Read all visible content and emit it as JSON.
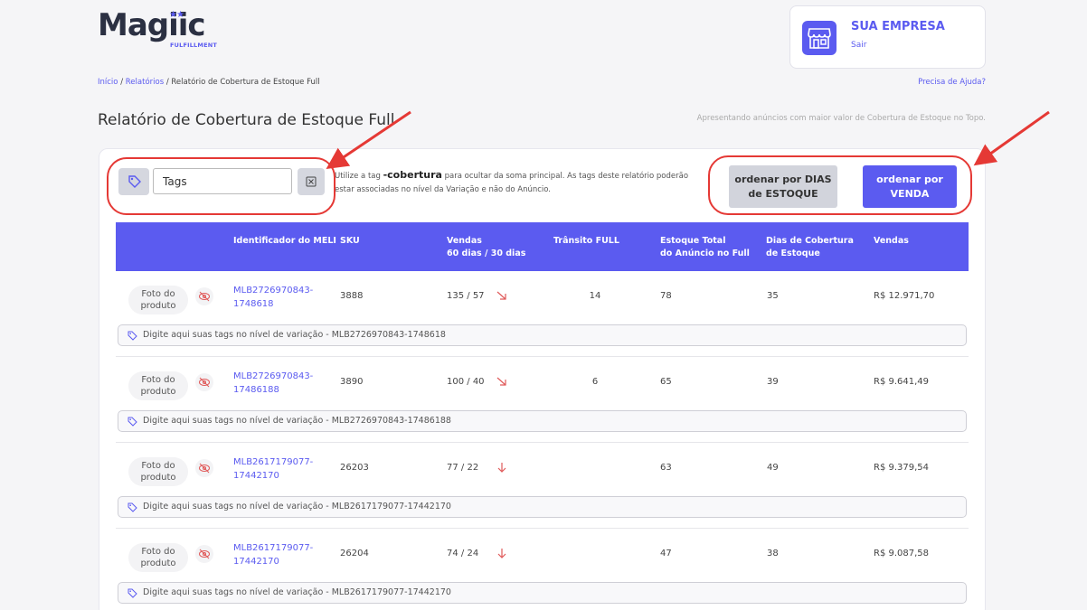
{
  "brand": {
    "logo_text": "Magiic",
    "logo_stars": "★★",
    "logo_sub": "FULFILLMENT",
    "accent": "#5b5bf0"
  },
  "company": {
    "name": "SUA EMPRESA",
    "logout": "Sair"
  },
  "breadcrumb": {
    "home": "Início",
    "reports": "Relatórios",
    "current": "Relatório de Cobertura de Estoque Full"
  },
  "help": "Precisa de Ajuda?",
  "page": {
    "title": "Relatório de Cobertura de Estoque Full",
    "subtitle": "Apresentando anúncios com maior valor de Cobertura de Estoque no Topo."
  },
  "filter": {
    "placeholder": "Tags",
    "info_before": "Utilize a tag ",
    "info_tag": "-cobertura",
    "info_after": " para ocultar da soma principal. As tags deste relatório poderão estar associadas no nível da Variação e não do Anúncio."
  },
  "sort": {
    "by_days_line1": "ordenar por DIAS",
    "by_days_line2": "de ESTOQUE",
    "by_sales_line1": "ordenar por",
    "by_sales_line2": "VENDA"
  },
  "table": {
    "headers": {
      "meli": "Identificador do MELI",
      "sku": "SKU",
      "sales_line1": "Vendas",
      "sales_line2": "60 dias / 30 dias",
      "transit": "Trânsito FULL",
      "stock_line1": "Estoque Total",
      "stock_line2": "do Anúncio no Full",
      "days_line1": "Dias de Cobertura",
      "days_line2": "de Estoque",
      "revenue": "Vendas"
    },
    "photo_label_line1": "Foto do",
    "photo_label_line2": "produto",
    "rows": [
      {
        "meli_line1": "MLB2726970843-",
        "meli_line2": "1748618",
        "sku": "3888",
        "sales": "135 / 57",
        "trend": "diagonal-down",
        "transit": "14",
        "stock": "78",
        "days": "35",
        "revenue": "R$ 12.971,70",
        "variation_tag": "Digite aqui suas tags no nível de variação - MLB2726970843-1748618"
      },
      {
        "meli_line1": "MLB2726970843-",
        "meli_line2": "17486188",
        "sku": "3890",
        "sales": "100 / 40",
        "trend": "diagonal-down",
        "transit": "6",
        "stock": "65",
        "days": "39",
        "revenue": "R$ 9.641,49",
        "variation_tag": "Digite aqui suas tags no nível de variação - MLB2726970843-17486188"
      },
      {
        "meli_line1": "MLB2617179077-",
        "meli_line2": "17442170",
        "sku": "26203",
        "sales": "77 / 22",
        "trend": "down",
        "transit": "",
        "stock": "63",
        "days": "49",
        "revenue": "R$ 9.379,54",
        "variation_tag": "Digite aqui suas tags no nível de variação - MLB2617179077-17442170"
      },
      {
        "meli_line1": "MLB2617179077-",
        "meli_line2": "17442170",
        "sku": "26204",
        "sales": "74 / 24",
        "trend": "down",
        "transit": "",
        "stock": "47",
        "days": "38",
        "revenue": "R$ 9.087,58",
        "variation_tag": "Digite aqui suas tags no nível de variação - MLB2617179077-17442170"
      }
    ]
  },
  "colors": {
    "annotation": "#e53935",
    "trend": "#e05a5a",
    "header_bg": "#5b5bf0"
  }
}
